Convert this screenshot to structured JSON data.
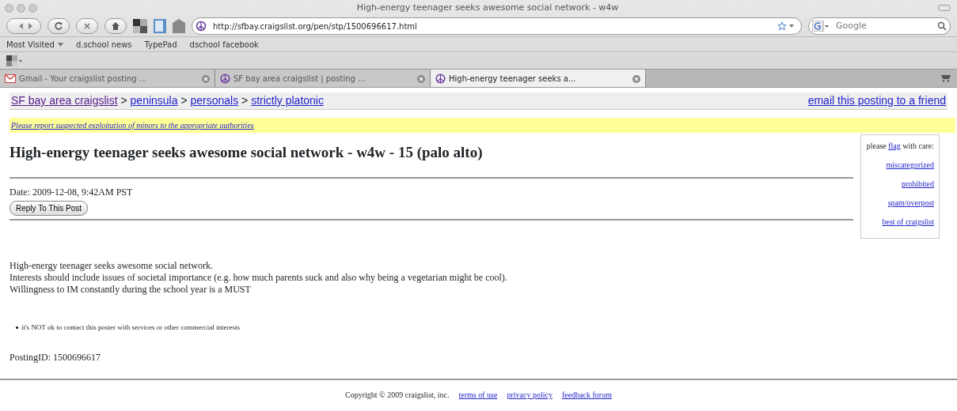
{
  "window": {
    "title": "High-energy teenager seeks awesome social network - w4w"
  },
  "address_bar": {
    "url": "http://sfbay.craigslist.org/pen/stp/1500696617.html"
  },
  "search": {
    "placeholder": "Google"
  },
  "bookmarks": [
    {
      "label": "Most Visited",
      "menu": true
    },
    {
      "label": "d.school news",
      "menu": false
    },
    {
      "label": "TypePad",
      "menu": false
    },
    {
      "label": "dschool facebook",
      "menu": false
    }
  ],
  "tabs": [
    {
      "label": "Gmail - Your craigslist posting ...",
      "kind": "mail",
      "selected": false
    },
    {
      "label": "SF bay area craigslist | posting ...",
      "kind": "peace",
      "selected": false
    },
    {
      "label": "High-energy teenager seeks a...",
      "kind": "peace",
      "selected": true
    }
  ],
  "breadcrumb": [
    {
      "label": "SF bay area craigslist",
      "visited": true
    },
    {
      "label": "peninsula",
      "visited": false
    },
    {
      "label": "personals",
      "visited": false
    },
    {
      "label": "strictly platonic",
      "visited": false
    }
  ],
  "breadcrumb_separator": ">",
  "email_link": "email this posting to a friend",
  "warning": "Please report suspected exploitation of minors to the appropriate authorities",
  "posting": {
    "title": "High-energy teenager seeks awesome social network - w4w - 15 (palo alto)",
    "date": "Date: 2009-12-08, 9:42AM PST",
    "reply_button": "Reply To This Post",
    "body": [
      "High-energy teenager seeks awesome social network.",
      "Interests should include issues of societal importance (e.g. how much parents suck and also why being a vegetarian might be cool).",
      "Willingness to IM constantly during the school year is a MUST"
    ],
    "notices": [
      "it's NOT ok to contact this poster with services or other commercial interests"
    ],
    "posting_id": "PostingID: 1500696617"
  },
  "flag_box": {
    "before": "please",
    "link": "flag",
    "after": "with care:",
    "options": [
      "miscategorized",
      "prohibited",
      "spam/overpost",
      "best of craigslist"
    ]
  },
  "footer": {
    "copyright": "Copyright © 2009 craigslist, inc.",
    "links": [
      "terms of use",
      "privacy policy",
      "feedback forum"
    ]
  }
}
